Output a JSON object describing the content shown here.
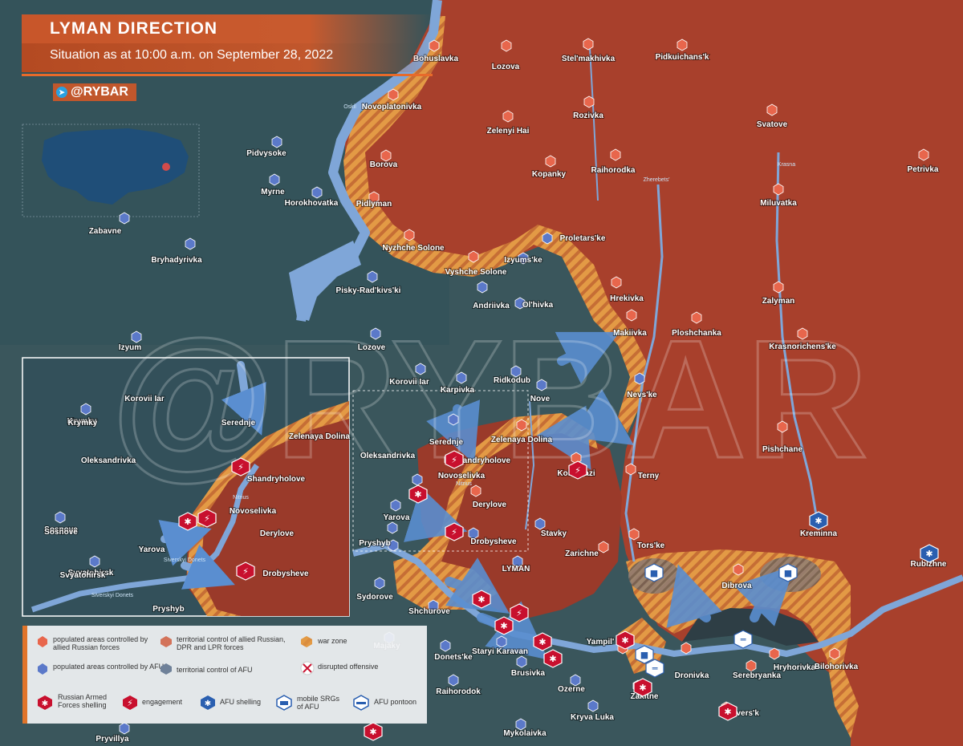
{
  "header": {
    "title": "LYMAN DIRECTION",
    "subtitle": "Situation as at 10:00 a.m. on September 28, 2022",
    "handle": "@RYBAR",
    "telegram_icon": "telegram-icon"
  },
  "watermark": "@RYBAR",
  "colors": {
    "russian_territory": "#a8402c",
    "afu_territory": "#3c5860",
    "war_zone": "#e39a45",
    "water": "#7fa6d8",
    "engagement": "#c8102e"
  },
  "places_russian": [
    {
      "name": "Bohuslavka"
    },
    {
      "name": "Lozova"
    },
    {
      "name": "Stel'makhivka"
    },
    {
      "name": "Pidkuichans'k"
    },
    {
      "name": "Novoplatonivka"
    },
    {
      "name": "Rozivka"
    },
    {
      "name": "Svatove"
    },
    {
      "name": "Zelenyi Hai"
    },
    {
      "name": "Borova"
    },
    {
      "name": "Kopanky"
    },
    {
      "name": "Raihorodka"
    },
    {
      "name": "Petrivka"
    },
    {
      "name": "Pidlyman"
    },
    {
      "name": "Miluvatka"
    },
    {
      "name": "Nyzhche Solone"
    },
    {
      "name": "Vyshche Solone"
    },
    {
      "name": "Hrekivka"
    },
    {
      "name": "Zalyman"
    },
    {
      "name": "Makiivka"
    },
    {
      "name": "Ploshchanka"
    },
    {
      "name": "Krasnorichens'ke"
    },
    {
      "name": "Pishchane"
    },
    {
      "name": "Terny"
    },
    {
      "name": "Zelenaya Dolina"
    },
    {
      "name": "Kolodyazi"
    },
    {
      "name": "Derylove"
    },
    {
      "name": "Zarichne"
    },
    {
      "name": "Tors'ke"
    },
    {
      "name": "Dibrova"
    },
    {
      "name": "Yampil'"
    },
    {
      "name": "Kreminna"
    },
    {
      "name": "Rubizhne"
    },
    {
      "name": "Dronivka"
    },
    {
      "name": "Serebryanka"
    },
    {
      "name": "Hryhorivka"
    },
    {
      "name": "Bilohorivka"
    },
    {
      "name": "Sivers'k"
    }
  ],
  "places_afu": [
    {
      "name": "Pidvysoke"
    },
    {
      "name": "Myrne"
    },
    {
      "name": "Horokhovatka"
    },
    {
      "name": "Zabavne"
    },
    {
      "name": "Bryhadyrivka"
    },
    {
      "name": "Izyum"
    },
    {
      "name": "Lozove"
    },
    {
      "name": "Korovii Iar"
    },
    {
      "name": "Karpivka"
    },
    {
      "name": "Ridkodub"
    },
    {
      "name": "Nove"
    },
    {
      "name": "Proletars'ke"
    },
    {
      "name": "Izyums'ke"
    },
    {
      "name": "Ol'hivka"
    },
    {
      "name": "Andriivka"
    },
    {
      "name": "Pisky-Rad'kivs'ki"
    },
    {
      "name": "Nevs'ke"
    },
    {
      "name": "Serednje"
    },
    {
      "name": "Shandryholove"
    },
    {
      "name": "Novoselivka"
    },
    {
      "name": "Oleksandrivka"
    },
    {
      "name": "Yarova"
    },
    {
      "name": "Pryshyb"
    },
    {
      "name": "Stavky"
    },
    {
      "name": "Drobysheve"
    },
    {
      "name": "LYMAN"
    },
    {
      "name": "Sydorove"
    },
    {
      "name": "Shchurove"
    },
    {
      "name": "Staryi Karavan"
    },
    {
      "name": "Donets'ke"
    },
    {
      "name": "Brusivka"
    },
    {
      "name": "Raihorodok"
    },
    {
      "name": "Ozerne"
    },
    {
      "name": "Zakitne"
    },
    {
      "name": "Kryva Luka"
    },
    {
      "name": "Mykolaivka"
    },
    {
      "name": "Majaky"
    },
    {
      "name": "Pryvillya"
    },
    {
      "name": "Krymky"
    },
    {
      "name": "Sosnove"
    },
    {
      "name": "Svyatohirsk"
    }
  ],
  "rivers": [
    {
      "name": "Oskil"
    },
    {
      "name": "Krasna"
    },
    {
      "name": "Zherebets'"
    },
    {
      "name": "Nitrius"
    },
    {
      "name": "Siverskyi Donets"
    }
  ],
  "inset": {
    "labels": [
      {
        "name": "Korovii Iar"
      },
      {
        "name": "Krymky"
      },
      {
        "name": "Oleksandrivka"
      },
      {
        "name": "Serednje"
      },
      {
        "name": "Zelenaya Dolina"
      },
      {
        "name": "Shandryholove"
      },
      {
        "name": "Nitrius"
      },
      {
        "name": "Novoselivka"
      },
      {
        "name": "Derylove"
      },
      {
        "name": "Sosnove"
      },
      {
        "name": "Yarova"
      },
      {
        "name": "Drobysheve"
      },
      {
        "name": "Svyatohirsk"
      },
      {
        "name": "Siverskyi Donets"
      },
      {
        "name": "Pryshyb"
      }
    ]
  },
  "legend": {
    "items": [
      {
        "icon": "red-pin-icon",
        "text": "populated areas controlled by allied Russian forces"
      },
      {
        "icon": "red-hex-icon",
        "text": "territorial control of allied Russian, DPR and LPR forces"
      },
      {
        "icon": "hatch-icon",
        "text": "war zone"
      },
      {
        "icon": "blue-pin-icon",
        "text": "populated areas controlled by AFU"
      },
      {
        "icon": "blue-hex-icon",
        "text": "territorial control of AFU"
      },
      {
        "icon": "cross-icon",
        "text": "disrupted offensive"
      },
      {
        "icon": "shelling-icon",
        "text": "Russian Armed Forces shelling"
      },
      {
        "icon": "engagement-icon",
        "text": "engagement"
      },
      {
        "icon": "afu-shelling-icon",
        "text": "AFU shelling"
      },
      {
        "icon": "srg-icon",
        "text": "mobile SRGs of AFU"
      },
      {
        "icon": "pontoon-icon",
        "text": "AFU pontoon"
      }
    ]
  }
}
